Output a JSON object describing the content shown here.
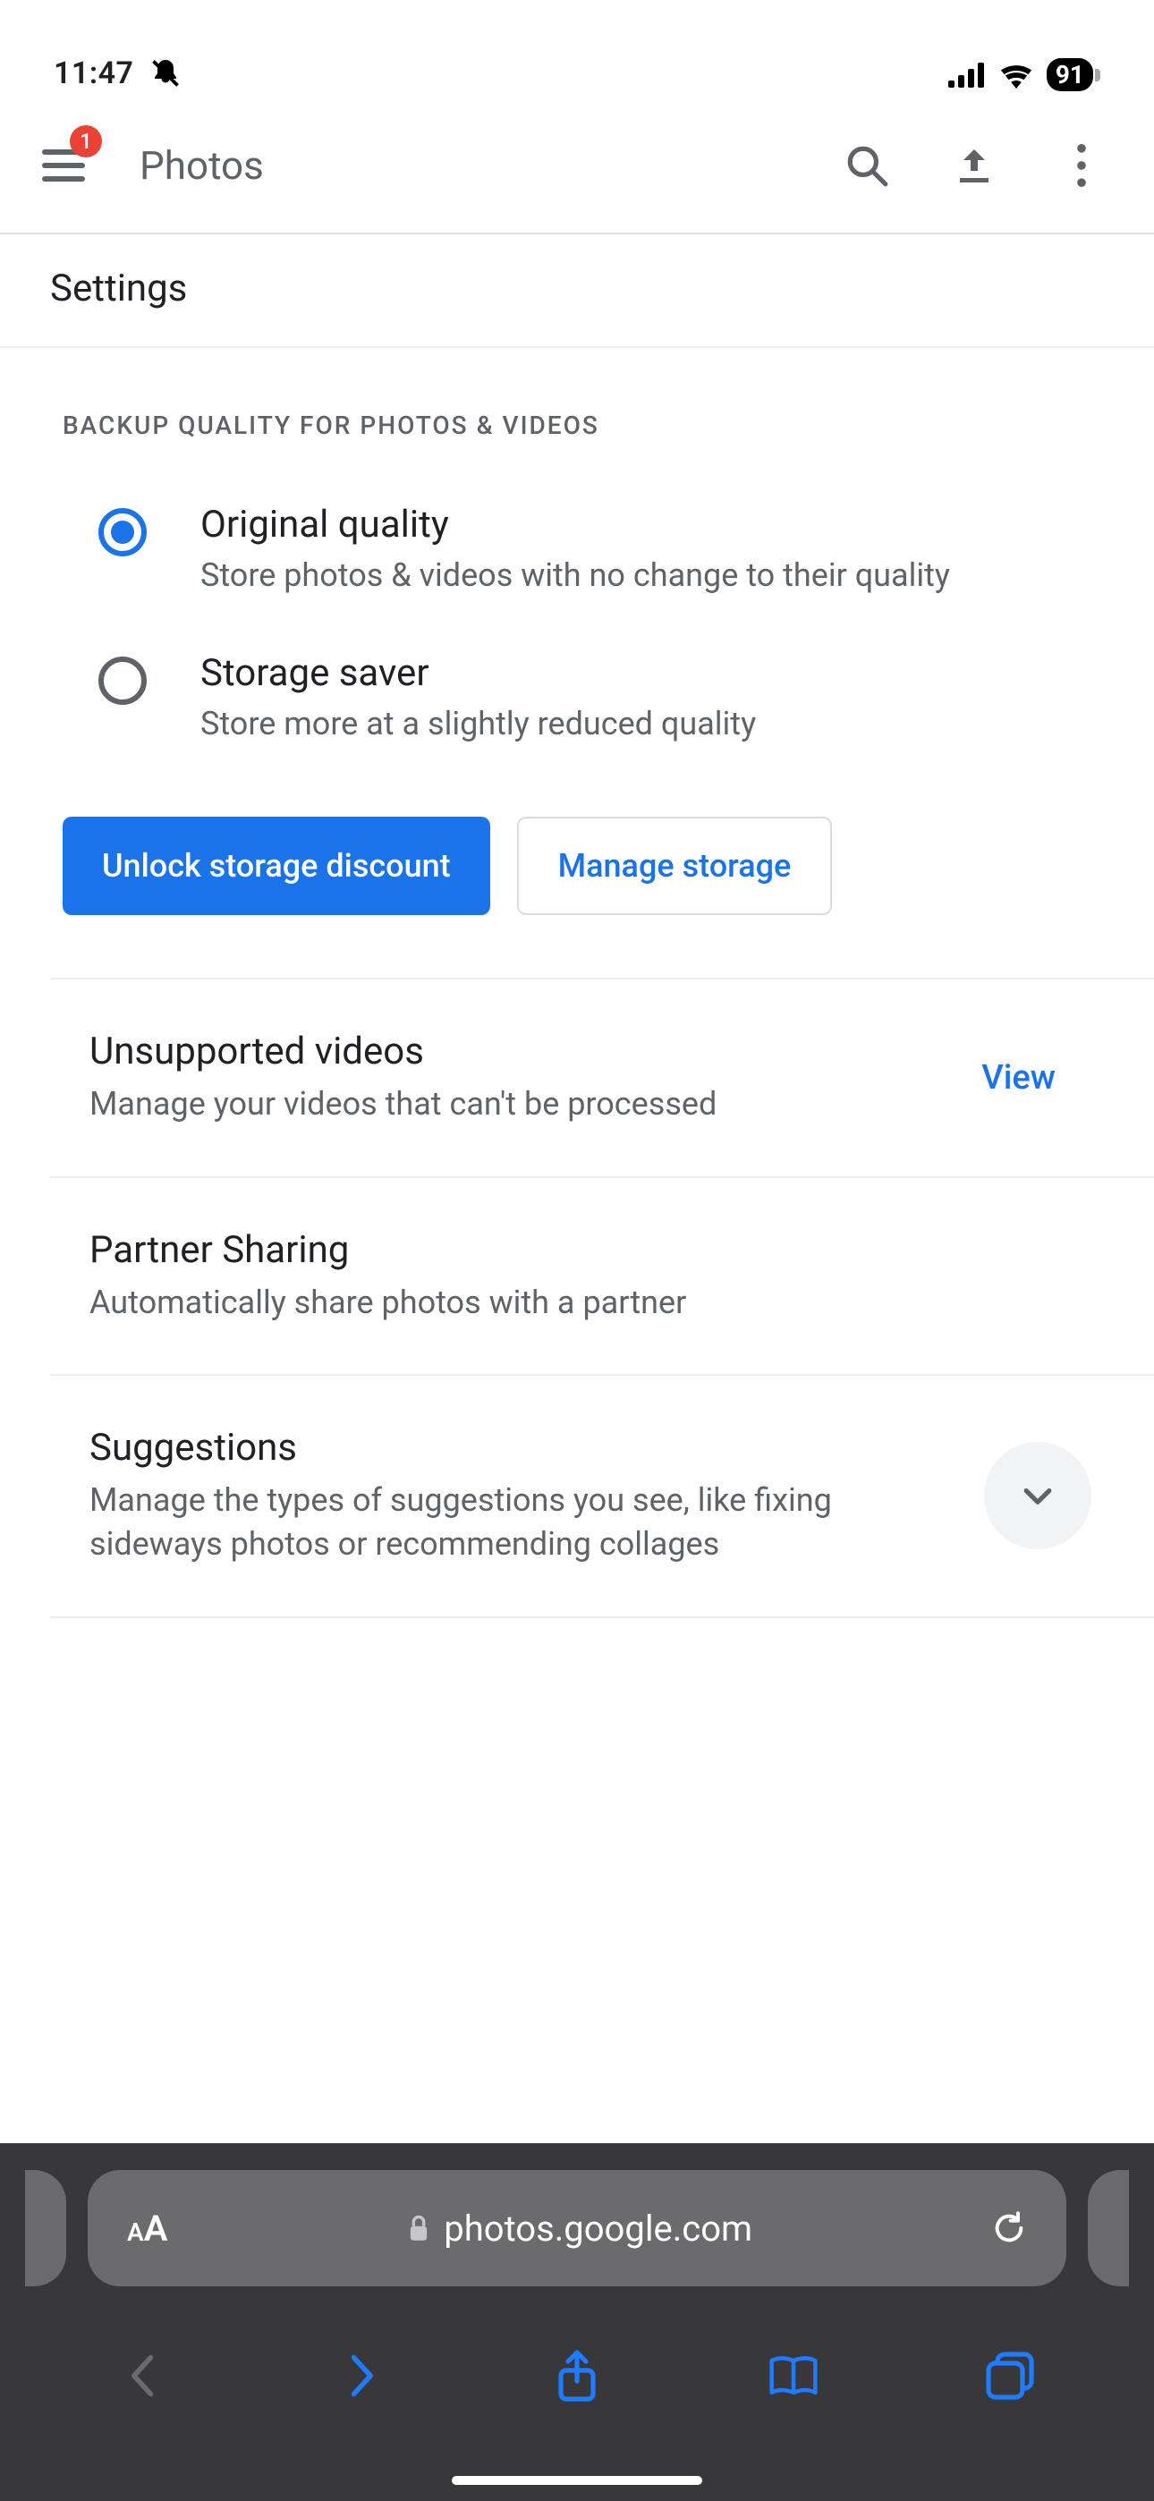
{
  "statusbar": {
    "time": "11:47",
    "battery": "91"
  },
  "appbar": {
    "menu_badge": "1",
    "title": "Photos"
  },
  "page": {
    "subtitle": "Settings"
  },
  "backup_section": {
    "heading": "BACKUP QUALITY FOR PHOTOS & VIDEOS",
    "options": [
      {
        "title": "Original quality",
        "desc": "Store photos & videos with no change to their quality",
        "selected": true
      },
      {
        "title": "Storage saver",
        "desc": "Store more at a slightly reduced quality",
        "selected": false
      }
    ],
    "primary_btn": "Unlock storage discount",
    "secondary_btn": "Manage storage"
  },
  "rows": {
    "unsupported": {
      "title": "Unsupported videos",
      "desc": "Manage your videos that can't be processed",
      "action": "View"
    },
    "partner": {
      "title": "Partner Sharing",
      "desc": "Automatically share photos with a partner"
    },
    "suggestions": {
      "title": "Suggestions",
      "desc": "Manage the types of suggestions you see, like fixing sideways photos or recommending collages"
    }
  },
  "safari": {
    "host": "photos.google.com"
  }
}
